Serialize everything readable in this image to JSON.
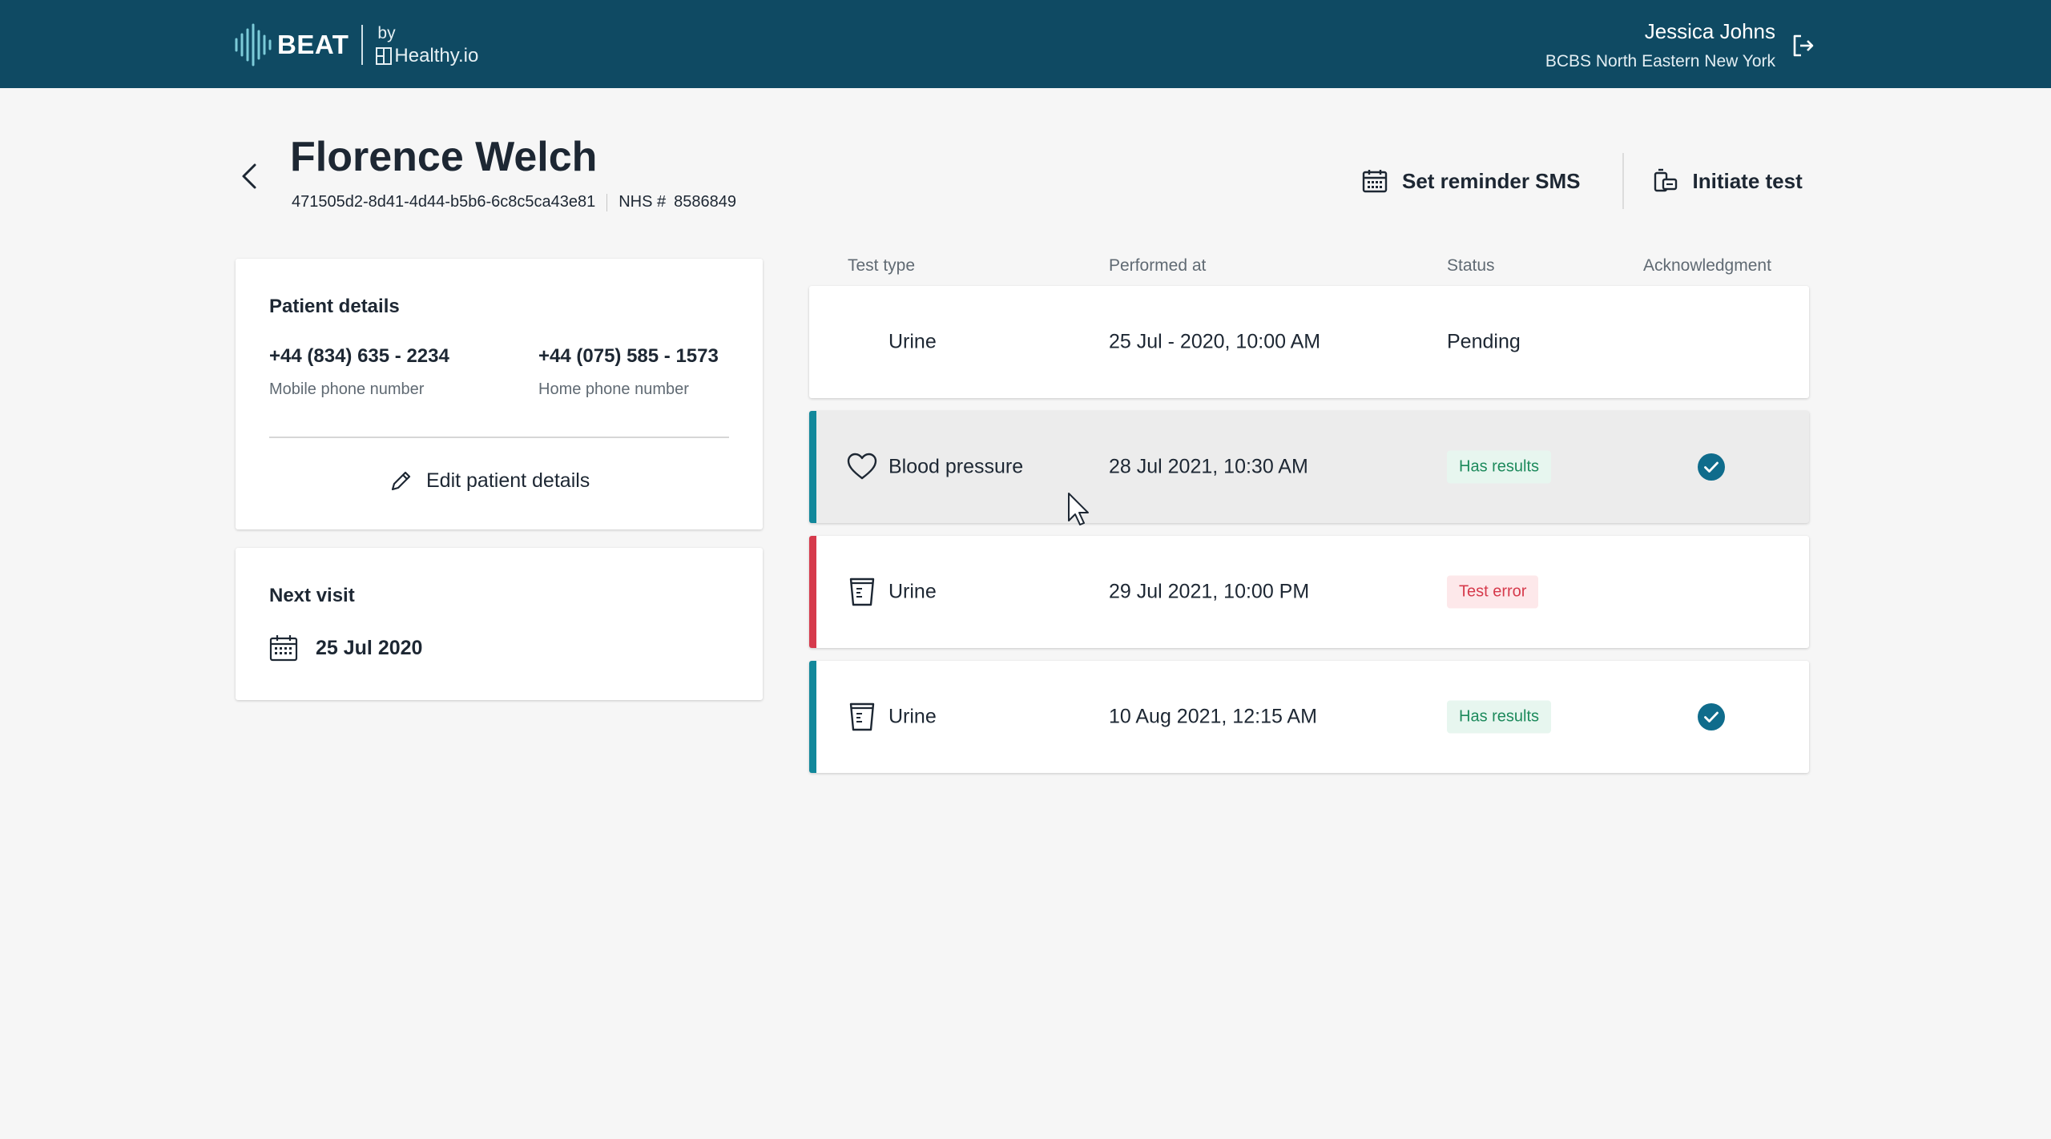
{
  "header": {
    "brand_name": "BEAT",
    "by_label": "by",
    "partner_name": "Healthy.io",
    "user_name": "Jessica Johns",
    "user_org": "BCBS North Eastern New York",
    "logout_icon": "logout-icon",
    "background": "#0f4a63"
  },
  "patient": {
    "name": "Florence Welch",
    "id": "471505d2-8d41-4d44-b5b6-6c8c5ca43e81",
    "nhs_label": "NHS #",
    "nhs_number": "8586849"
  },
  "actions": {
    "set_reminder": "Set reminder SMS",
    "initiate_test": "Initiate test"
  },
  "details_card": {
    "title": "Patient details",
    "mobile_phone": "+44 (834) 635 - 2234",
    "mobile_label": "Mobile phone number",
    "home_phone": "+44 (075) 585 - 1573",
    "home_label": "Home phone number",
    "edit_label": "Edit patient details"
  },
  "visit_card": {
    "title": "Next visit",
    "date": "25 Jul 2020"
  },
  "table": {
    "columns": [
      "Test type",
      "Performed at",
      "Status",
      "Acknowledgment"
    ],
    "rows": [
      {
        "type": "Urine",
        "date": "25 Jul - 2020, 10:00 AM",
        "status": "Pending",
        "icon": "none",
        "acknowledged": false,
        "stripe": "none"
      },
      {
        "type": "Blood pressure",
        "date": "28 Jul 2021, 10:30 AM",
        "status": "Has results",
        "icon": "heart-icon",
        "acknowledged": true,
        "stripe": "#12889b"
      },
      {
        "type": "Urine",
        "date": "29 Jul 2021, 10:00 PM",
        "status": "Test error",
        "icon": "urine-cup-icon",
        "acknowledged": false,
        "stripe": "#d63a4c"
      },
      {
        "type": "Urine",
        "date": "10 Aug 2021, 12:15 AM",
        "status": "Has results",
        "icon": "urine-cup-icon",
        "acknowledged": true,
        "stripe": "#12889b"
      }
    ]
  },
  "colors": {
    "accent": "#12889b",
    "error": "#d63a4c",
    "success_text": "#1d8a5c",
    "check_badge": "#0f6c8c"
  }
}
